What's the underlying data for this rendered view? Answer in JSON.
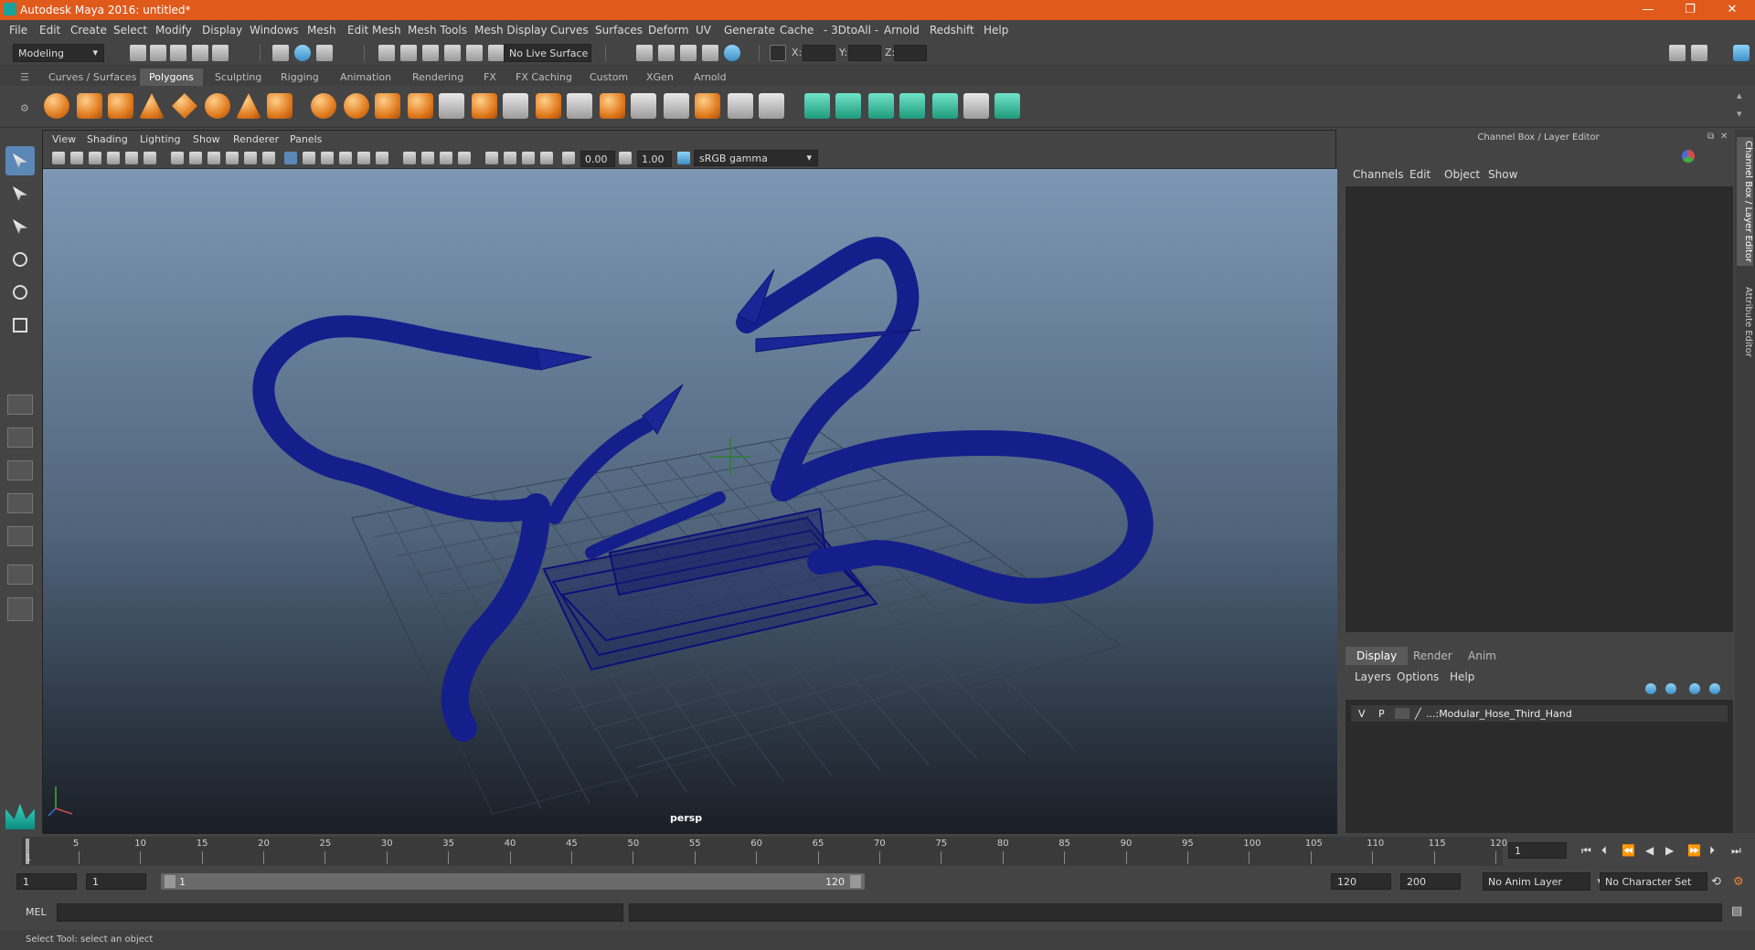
{
  "titlebar": {
    "title": "Autodesk Maya 2016: untitled*",
    "minimize": "—",
    "restore": "❐",
    "close": "✕"
  },
  "menubar": [
    "File",
    "Edit",
    "Create",
    "Select",
    "Modify",
    "Display",
    "Windows",
    "Mesh",
    "Edit Mesh",
    "Mesh Tools",
    "Mesh Display",
    "Curves",
    "Surfaces",
    "Deform",
    "UV",
    "Generate",
    "Cache",
    "- 3DtoAll -",
    "Arnold",
    "Redshift",
    "Help"
  ],
  "statusline": {
    "mode": "Modeling",
    "live_surface": "No Live Surface",
    "x_label": "X:",
    "y_label": "Y:",
    "z_label": "Z:"
  },
  "shelf_tabs": [
    "Curves / Surfaces",
    "Polygons",
    "Sculpting",
    "Rigging",
    "Animation",
    "Rendering",
    "FX",
    "FX Caching",
    "Custom",
    "XGen",
    "Arnold"
  ],
  "active_shelf_tab": "Polygons",
  "viewport": {
    "menu": [
      "View",
      "Shading",
      "Lighting",
      "Show",
      "Renderer",
      "Panels"
    ],
    "exposure": "0.00",
    "gamma": "1.00",
    "color_space": "sRGB gamma",
    "camera": "persp"
  },
  "rightpanel": {
    "title": "Channel Box / Layer Editor",
    "menu": [
      "Channels",
      "Edit",
      "Object",
      "Show"
    ],
    "layer_tabs": [
      "Display",
      "Render",
      "Anim"
    ],
    "layer_menu": [
      "Layers",
      "Options",
      "Help"
    ],
    "layer": {
      "v": "V",
      "p": "P",
      "name": "...:Modular_Hose_Third_Hand"
    },
    "side_tabs": [
      "Channel Box / Layer Editor",
      "Attribute Editor"
    ]
  },
  "timeline": {
    "ticks": [
      "5",
      "10",
      "15",
      "20",
      "25",
      "30",
      "35",
      "40",
      "45",
      "50",
      "55",
      "60",
      "65",
      "70",
      "75",
      "80",
      "85",
      "90",
      "95",
      "100",
      "105",
      "110",
      "115",
      "120"
    ],
    "current_frame_marker": "1",
    "current_frame": "1"
  },
  "range": {
    "start": "1",
    "playback_start": "1",
    "bar_start": "1",
    "bar_end": "120",
    "playback_end": "120",
    "end": "200",
    "anim_layer": "No Anim Layer",
    "character_set": "No Character Set"
  },
  "cmdline": {
    "label": "MEL"
  },
  "helpline": {
    "text": "Select Tool: select an object"
  }
}
